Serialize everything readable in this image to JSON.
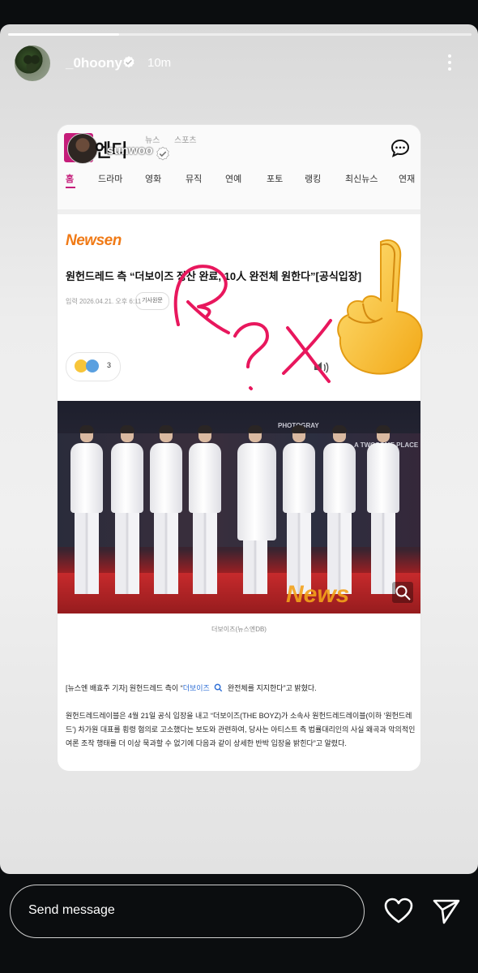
{
  "story": {
    "progress_fraction": 0.24,
    "username": "_0hoony",
    "time_ago": "10m"
  },
  "article": {
    "site_name": "엔디",
    "top_links": [
      "뉴스",
      "스포츠"
    ],
    "overlay_mention": "sunwoo",
    "nav": [
      "홈",
      "드라마",
      "영화",
      "뮤직",
      "연예",
      "포토",
      "랭킹",
      "최신뉴스",
      "연재"
    ],
    "brand": "Newsen",
    "headline": "원헌드레드 측 “더보이즈 정산 완료, 10人 완전체 원한다”[공식입장]",
    "meta_date": "입력 2026.04.21. 오후 6:11",
    "meta_button": "기사원문",
    "reaction_count": "3",
    "backdrop_texts": [
      "PHOTOGRAY",
      "A TWOSOME PLACE"
    ],
    "watermark": "News",
    "caption": "더보이즈(뉴스엔DB)",
    "p1_before": "[뉴스엔 배효주 기자] 원헌드레드 측이 “",
    "p1_link": "더보이즈",
    "p1_after": " 완전체를 지지한다”고 밝혔다.",
    "p2": "원헌드레드레이블은 4월 21일 공식 입장을 내고 “더보이즈(THE BOYZ)가 소속사 원헌드레드레이블(이하 '원헌드레드') 차가원 대표를 횡령 혐의로 고소했다는 보도와 관련하여, 당사는 아티스트 측 법률대리인의 사실 왜곡과 악의적인 여론 조작 행태를 더 이상 묵과할 수 없기에 다음과 같이 상세한 반박 입장을 밝힌다”고 알렸다."
  },
  "doodle": {
    "text": "R?X",
    "color": "#e8175d",
    "emoji": "☝"
  },
  "bottom_bar": {
    "message_placeholder": "Send message"
  }
}
